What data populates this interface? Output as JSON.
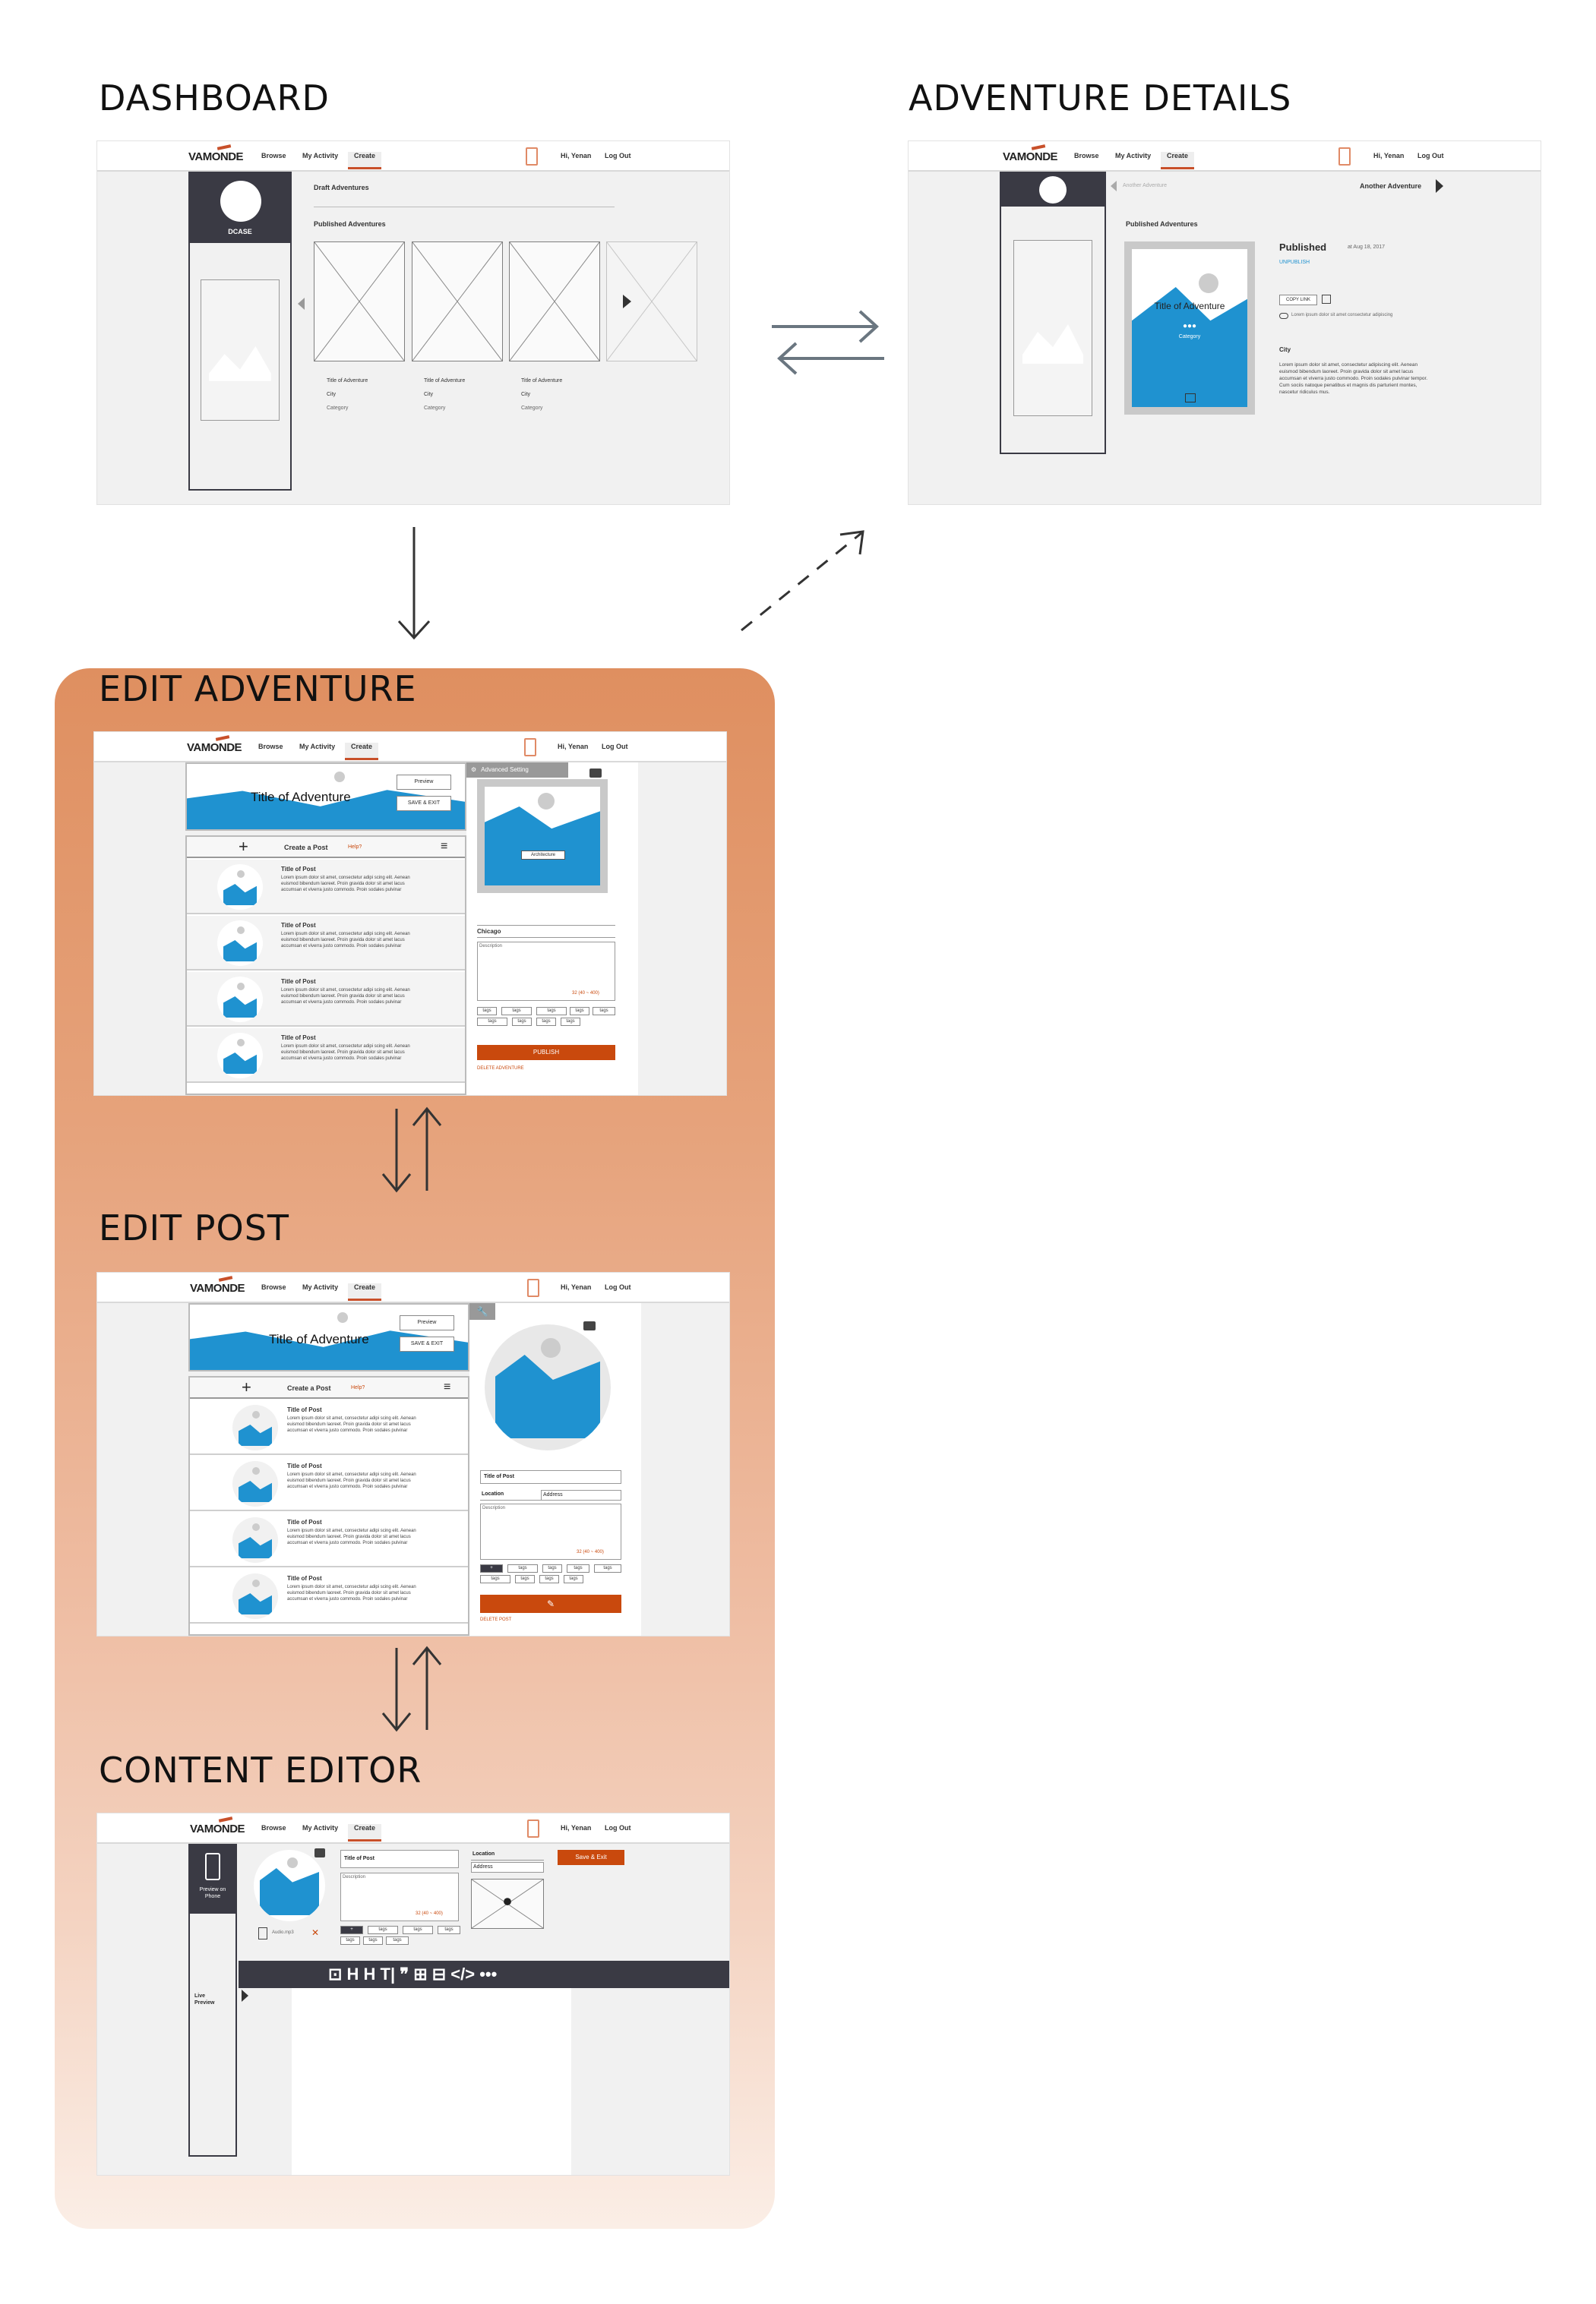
{
  "titles": {
    "dashboard": "DASHBOARD",
    "details": "ADVENTURE DETAILS",
    "edit_adventure": "EDIT ADVENTURE",
    "edit_post": "EDIT POST",
    "content_editor": "CONTENT EDITOR"
  },
  "nav": {
    "logo": "VAMONDE",
    "browse": "Browse",
    "activity": "My Activity",
    "create": "Create",
    "greeting": "Hi, Yenan",
    "logout": "Log Out"
  },
  "dashboard": {
    "user": "DCASE",
    "drafts": "Draft Adventures",
    "published": "Published Adventures",
    "cards": [
      {
        "title": "Title of Adventure",
        "city": "City",
        "category": "Category"
      },
      {
        "title": "Title of Adventure",
        "city": "City",
        "category": "Category"
      },
      {
        "title": "Title of Adventure",
        "city": "City",
        "category": "Category"
      }
    ]
  },
  "details": {
    "prev": "Another Adventure",
    "next": "Another Adventure",
    "published_label": "Published Adventures",
    "card_title": "Title of Adventure",
    "card_category": "Category",
    "status": "Published",
    "date": "at Aug 18, 2017",
    "unpublish": "UNPUBLISH",
    "copy_link": "COPY LINK",
    "note": "Lorem ipsum dolor sit amet consectetur adipiscing",
    "city": "City",
    "body": "Lorem ipsum dolor sit amet, consectetur adipiscing elit. Aenean euismod bibendum laoreet. Proin gravida dolor sit amet lacus accumsan et viverra justo commodo. Proin sodales pulvinar tempor. Cum sociis natoque penatibus et magnis dis parturient montes, nascetur ridiculus mus."
  },
  "edit_adventure": {
    "hero_title": "Title of Adventure",
    "preview": "Preview",
    "save_exit": "SAVE & EXIT",
    "create_post": "Create a Post",
    "help": "Help?",
    "advanced": "Advanced Setting",
    "category_select": "Architecture",
    "city_value": "Chicago",
    "description": "Description",
    "counter": "32 (40 ~ 400)",
    "tag": "tags",
    "publish": "PUBLISH",
    "delete": "DELETE ADVENTURE",
    "posts": [
      {
        "title": "Title of Post",
        "body": "Lorem ipsum dolor sit amet, consectetur adipi scing elit. Aenean euismod bibendum laoreet. Proin gravida dolor sit amet lacus accumsan et viverra justo commodo. Proin sodales pulvinar"
      },
      {
        "title": "Title of Post",
        "body": "Lorem ipsum dolor sit amet, consectetur adipi scing elit. Aenean euismod bibendum laoreet. Proin gravida dolor sit amet lacus accumsan et viverra justo commodo. Proin sodales pulvinar"
      },
      {
        "title": "Title of Post",
        "body": "Lorem ipsum dolor sit amet, consectetur adipi scing elit. Aenean euismod bibendum laoreet. Proin gravida dolor sit amet lacus accumsan et viverra justo commodo. Proin sodales pulvinar"
      },
      {
        "title": "Title of Post",
        "body": "Lorem ipsum dolor sit amet, consectetur adipi scing elit. Aenean euismod bibendum laoreet. Proin gravida dolor sit amet lacus accumsan et viverra justo commodo. Proin sodales pulvinar"
      }
    ]
  },
  "edit_post": {
    "title_field": "Title of Post",
    "location": "Location",
    "address": "Address",
    "delete": "DELETE POST"
  },
  "content_editor": {
    "preview_phone": "Preview on Phone",
    "live_preview": "Live Preview",
    "audio": "Audio.mp3",
    "save_exit": "Save & Exit",
    "toolbar": "⊡  H H  T| ❞  ⊞  ⊟  </>  •••"
  },
  "colors": {
    "accent": "#c9490d",
    "hero_blue": "#1f92d0",
    "dark": "#3a3a44"
  }
}
